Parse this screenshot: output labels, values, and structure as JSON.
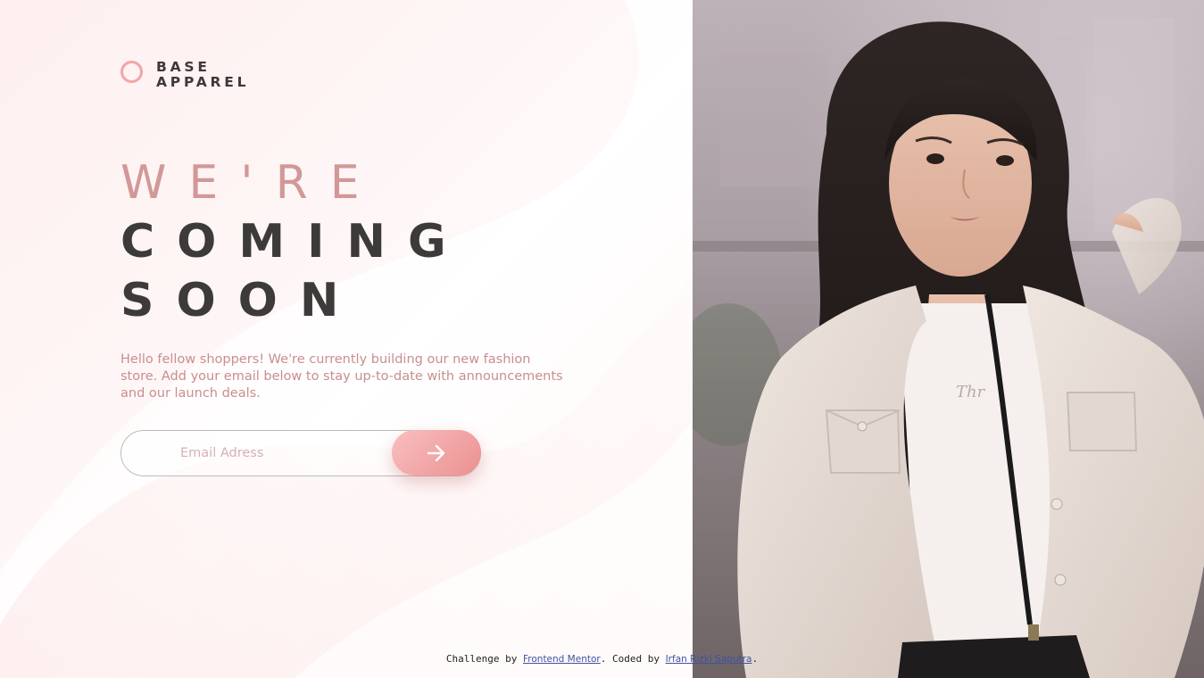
{
  "brand": {
    "line1": "BASE",
    "line2": "APPAREL",
    "accent_color": "#f0a6a6"
  },
  "headline": {
    "line1": "WE'RE",
    "line2": "COMING",
    "line3": "SOON"
  },
  "description": "Hello fellow shoppers! We're currently building our new fashion store. Add your email below to stay up-to-date with announcements and our launch deals.",
  "form": {
    "email_placeholder": "Email Adress",
    "submit_icon": "arrow-right-icon"
  },
  "hero": {
    "image_alt": "hero-photo-woman-in-white-jacket"
  },
  "attribution": {
    "prefix": "Challenge by ",
    "challenge_link": "Frontend Mentor",
    "middle": ". Coded by ",
    "author_link": "Irfan Rizki Saputra",
    "suffix": "."
  },
  "colors": {
    "heading_light": "#d29898",
    "heading_dark": "#3d3a3a",
    "body_text": "#c98e8e",
    "button_gradient_start": "#f8bfbf",
    "button_gradient_end": "#ec9090"
  }
}
